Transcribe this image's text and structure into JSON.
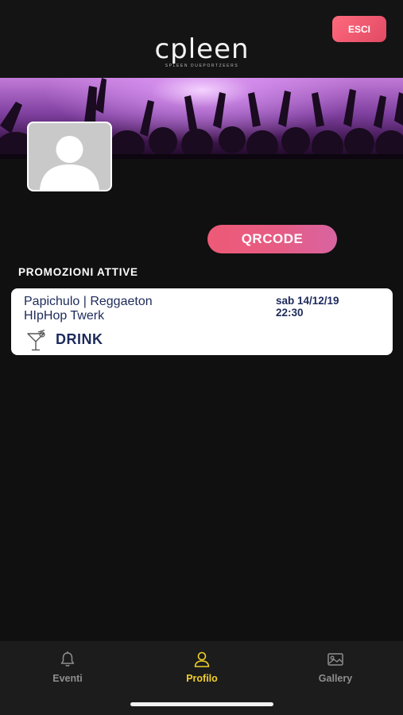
{
  "header": {
    "logo_text": "cpleen",
    "logo_subtitle": "SPLEEN DUEPORTZEERS",
    "exit_label": "ESCI"
  },
  "profile": {
    "qrcode_label": "QRCODE"
  },
  "promotions": {
    "section_title": "PROMOZIONI ATTIVE",
    "items": [
      {
        "title_line1": "Papichulo | Reggaeton",
        "title_line2": "HIpHop Twerk",
        "date": "sab 14/12/19",
        "time": "22:30",
        "type": "DRINK",
        "icon": "cocktail-icon"
      }
    ]
  },
  "nav": {
    "items": [
      {
        "label": "Eventi",
        "icon": "bell-icon",
        "active": false
      },
      {
        "label": "Profilo",
        "icon": "user-icon",
        "active": true
      },
      {
        "label": "Gallery",
        "icon": "image-icon",
        "active": false
      }
    ]
  },
  "colors": {
    "accent_pink": "#ee5a77",
    "active_nav": "#f0cf2a",
    "card_text": "#1d2a5b",
    "background": "#101010"
  }
}
